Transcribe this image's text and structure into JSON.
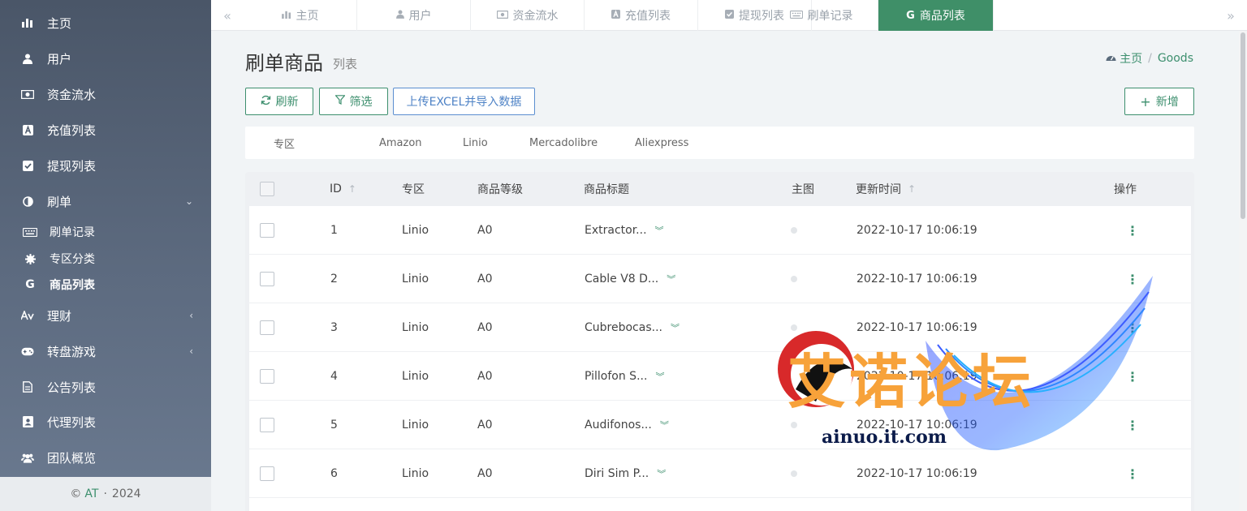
{
  "sidebar": {
    "items": [
      {
        "label": "主页",
        "icon": "bar-chart-icon"
      },
      {
        "label": "用户",
        "icon": "user-icon"
      },
      {
        "label": "资金流水",
        "icon": "money-icon"
      },
      {
        "label": "充值列表",
        "icon": "a-square-icon"
      },
      {
        "label": "提现列表",
        "icon": "check-square-icon"
      },
      {
        "label": "刷单",
        "icon": "half-circle-icon",
        "caret": "⌄"
      },
      {
        "label": "理财",
        "icon": "finance-icon",
        "caret": "‹"
      },
      {
        "label": "转盘游戏",
        "icon": "gamepad-icon",
        "caret": "‹"
      },
      {
        "label": "公告列表",
        "icon": "document-icon"
      },
      {
        "label": "代理列表",
        "icon": "id-card-icon"
      },
      {
        "label": "团队概览",
        "icon": "users-icon"
      }
    ],
    "sub_items": [
      {
        "label": "刷单记录",
        "icon": "keyboard-icon"
      },
      {
        "label": "专区分类",
        "icon": "gear-icon"
      },
      {
        "label": "商品列表",
        "icon": "google-icon"
      }
    ],
    "footer": {
      "copyright": "©",
      "brand": "AT",
      "dot": "·",
      "year": "2024"
    }
  },
  "tabs": [
    {
      "label": "主页",
      "icon": "bar-chart-icon"
    },
    {
      "label": "用户",
      "icon": "user-icon"
    },
    {
      "label": "资金流水",
      "icon": "money-icon"
    },
    {
      "label": "充值列表",
      "icon": "a-square-icon"
    },
    {
      "label": "提现列表",
      "icon": "check-square-icon"
    },
    {
      "label": "刷单记录",
      "icon": "keyboard-icon"
    },
    {
      "label": "商品列表",
      "icon": "google-icon"
    }
  ],
  "page": {
    "title": "刷单商品",
    "subtitle": "列表",
    "breadcrumb_home": "主页",
    "breadcrumb_sep": "/",
    "breadcrumb_current": "Goods"
  },
  "toolbar": {
    "refresh": "刷新",
    "filter": "筛选",
    "upload": "上传EXCEL并导入数据",
    "add": "新增"
  },
  "zones": [
    "专区",
    "Amazon",
    "Linio",
    "Mercadolibre",
    "Aliexpress"
  ],
  "table": {
    "headers": {
      "id": "ID",
      "zone": "专区",
      "level": "商品等级",
      "title": "商品标题",
      "image": "主图",
      "updated": "更新时间",
      "ops": "操作"
    },
    "rows": [
      {
        "id": "1",
        "zone": "Linio",
        "level": "A0",
        "title": "Extractor...",
        "updated": "2022-10-17 10:06:19"
      },
      {
        "id": "2",
        "zone": "Linio",
        "level": "A0",
        "title": "Cable V8 D...",
        "updated": "2022-10-17 10:06:19"
      },
      {
        "id": "3",
        "zone": "Linio",
        "level": "A0",
        "title": "Cubrebocas...",
        "updated": "2022-10-17 10:06:19"
      },
      {
        "id": "4",
        "zone": "Linio",
        "level": "A0",
        "title": "Pillofon S...",
        "updated": "2022-10-17 10:06:19"
      },
      {
        "id": "5",
        "zone": "Linio",
        "level": "A0",
        "title": "Audifonos...",
        "updated": "2022-10-17 10:06:19"
      },
      {
        "id": "6",
        "zone": "Linio",
        "level": "A0",
        "title": "Diri Sim P...",
        "updated": "2022-10-17 10:06:19"
      }
    ]
  },
  "watermark": {
    "text": "艾诺论坛",
    "url": "ainuo.it.com"
  },
  "colors": {
    "accent": "#3f8f68",
    "sidebar": "#4a5668",
    "link_blue": "#4f83c6"
  }
}
